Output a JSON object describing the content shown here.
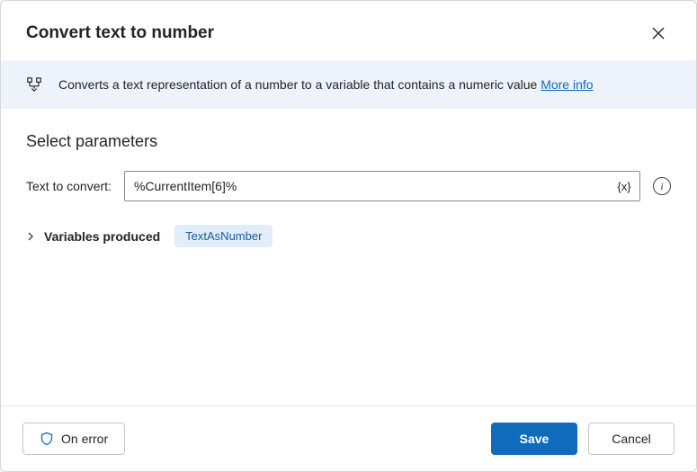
{
  "dialog": {
    "title": "Convert text to number",
    "banner": {
      "text": "Converts a text representation of a number to a variable that contains a numeric value ",
      "link_label": "More info"
    },
    "section_title": "Select parameters",
    "params": {
      "text_to_convert": {
        "label": "Text to convert:",
        "value": "%CurrentItem[6]%",
        "variable_button_glyph": "{x}"
      }
    },
    "variables_produced": {
      "label": "Variables produced",
      "chips": [
        "TextAsNumber"
      ]
    },
    "footer": {
      "on_error": "On error",
      "save": "Save",
      "cancel": "Cancel"
    }
  }
}
